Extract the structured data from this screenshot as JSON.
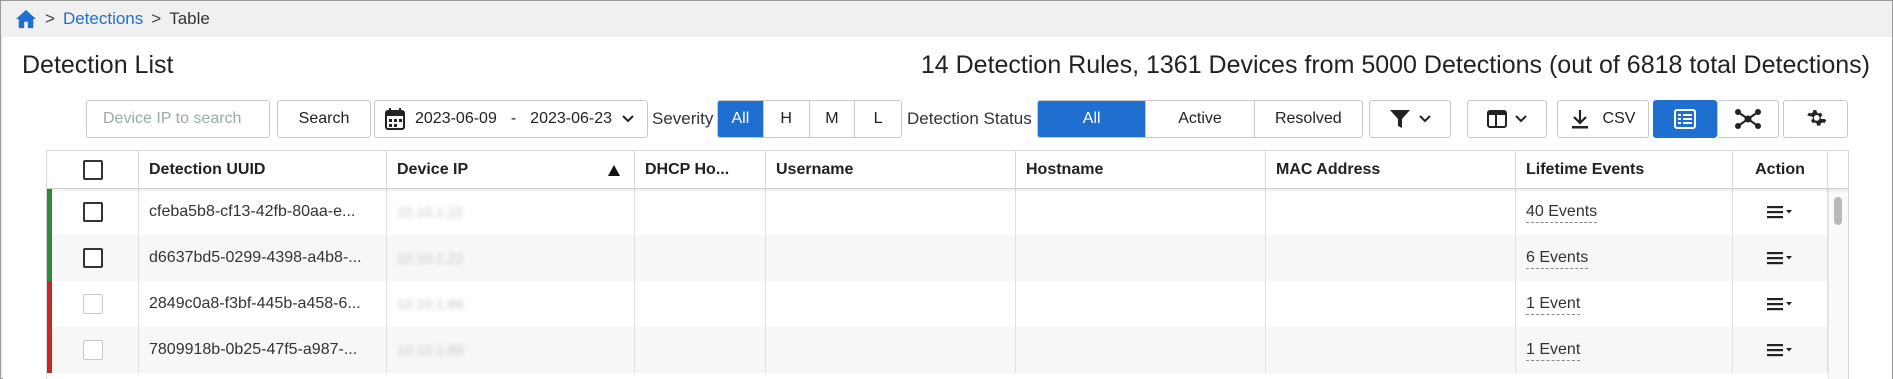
{
  "breadcrumb": {
    "sep1": ">",
    "link": "Detections",
    "sep2": ">",
    "current": "Table"
  },
  "header": {
    "title": "Detection List",
    "summary": "14 Detection Rules, 1361 Devices from 5000 Detections (out of 6818 total Detections)"
  },
  "toolbar": {
    "search_placeholder": "Device IP to search",
    "search_label": "Search",
    "date_start": "2023-06-09",
    "date_sep": "-",
    "date_end": "2023-06-23",
    "severity_label": "Severity",
    "severity_options": [
      "All",
      "H",
      "M",
      "L"
    ],
    "severity_selected": "All",
    "status_label": "Detection Status",
    "status_options": [
      "All",
      "Active",
      "Resolved"
    ],
    "status_selected": "All",
    "csv_label": "CSV"
  },
  "table": {
    "columns": [
      "Detection UUID",
      "Device IP",
      "DHCP Ho...",
      "Username",
      "Hostname",
      "MAC Address",
      "Lifetime Events",
      "Action"
    ],
    "rows": [
      {
        "uuid": "cfeba5b8-cf13-42fb-80aa-e...",
        "ip": "10.10.1.22",
        "events": "40 Events",
        "severity_color": "#2e8b3a",
        "checkbox_enabled": true
      },
      {
        "uuid": "d6637bd5-0299-4398-a4b8-...",
        "ip": "10.10.1.22",
        "events": "6 Events",
        "severity_color": "#2e8b3a",
        "checkbox_enabled": true
      },
      {
        "uuid": "2849c0a8-f3bf-445b-a458-6...",
        "ip": "10.10.1.89",
        "events": "1 Event",
        "severity_color": "#c62828",
        "checkbox_enabled": false
      },
      {
        "uuid": "7809918b-0b25-47f5-a987-...",
        "ip": "10.10.1.89",
        "events": "1 Event",
        "severity_color": "#c62828",
        "checkbox_enabled": false
      }
    ]
  },
  "colors": {
    "accent": "#1f6fd1",
    "severity_low": "#2e8b3a",
    "severity_high": "#c62828"
  },
  "icons": [
    "home-icon",
    "calendar-icon",
    "chevron-down-icon",
    "filter-icon",
    "columns-icon",
    "download-icon",
    "list-view-icon",
    "graph-view-icon",
    "gear-icon",
    "row-menu-icon",
    "sort-ascending-icon"
  ]
}
